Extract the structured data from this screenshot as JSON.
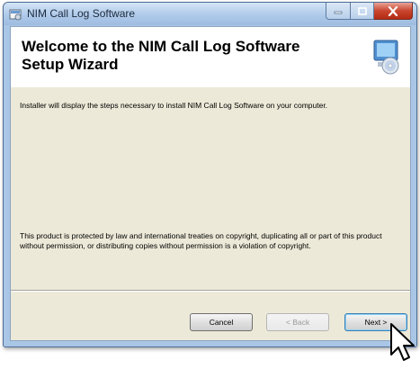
{
  "window": {
    "title": "NIM Call Log Software",
    "caption_buttons": {
      "minimize": "minimize",
      "maximize": "maximize",
      "close": "close"
    }
  },
  "header": {
    "title": "Welcome to the NIM Call Log Software Setup Wizard"
  },
  "body": {
    "intro": "Installer will display the steps necessary to install NIM Call Log Software on your computer.",
    "legal": "This product is protected by law and international treaties on copyright, duplicating all or part of this product without permission, or distributing copies without permission is a violation of copyright."
  },
  "buttons": {
    "cancel": "Cancel",
    "back": "< Back",
    "next": "Next >"
  },
  "icons": {
    "app": "installer-icon",
    "header_art": "computer-cd-icon",
    "cursor": "mouse-pointer-icon"
  },
  "colors": {
    "titlebar": "#afcaea",
    "close_button": "#c9452f",
    "dialog_bg": "#ece9d8",
    "header_bg": "#ffffff"
  }
}
